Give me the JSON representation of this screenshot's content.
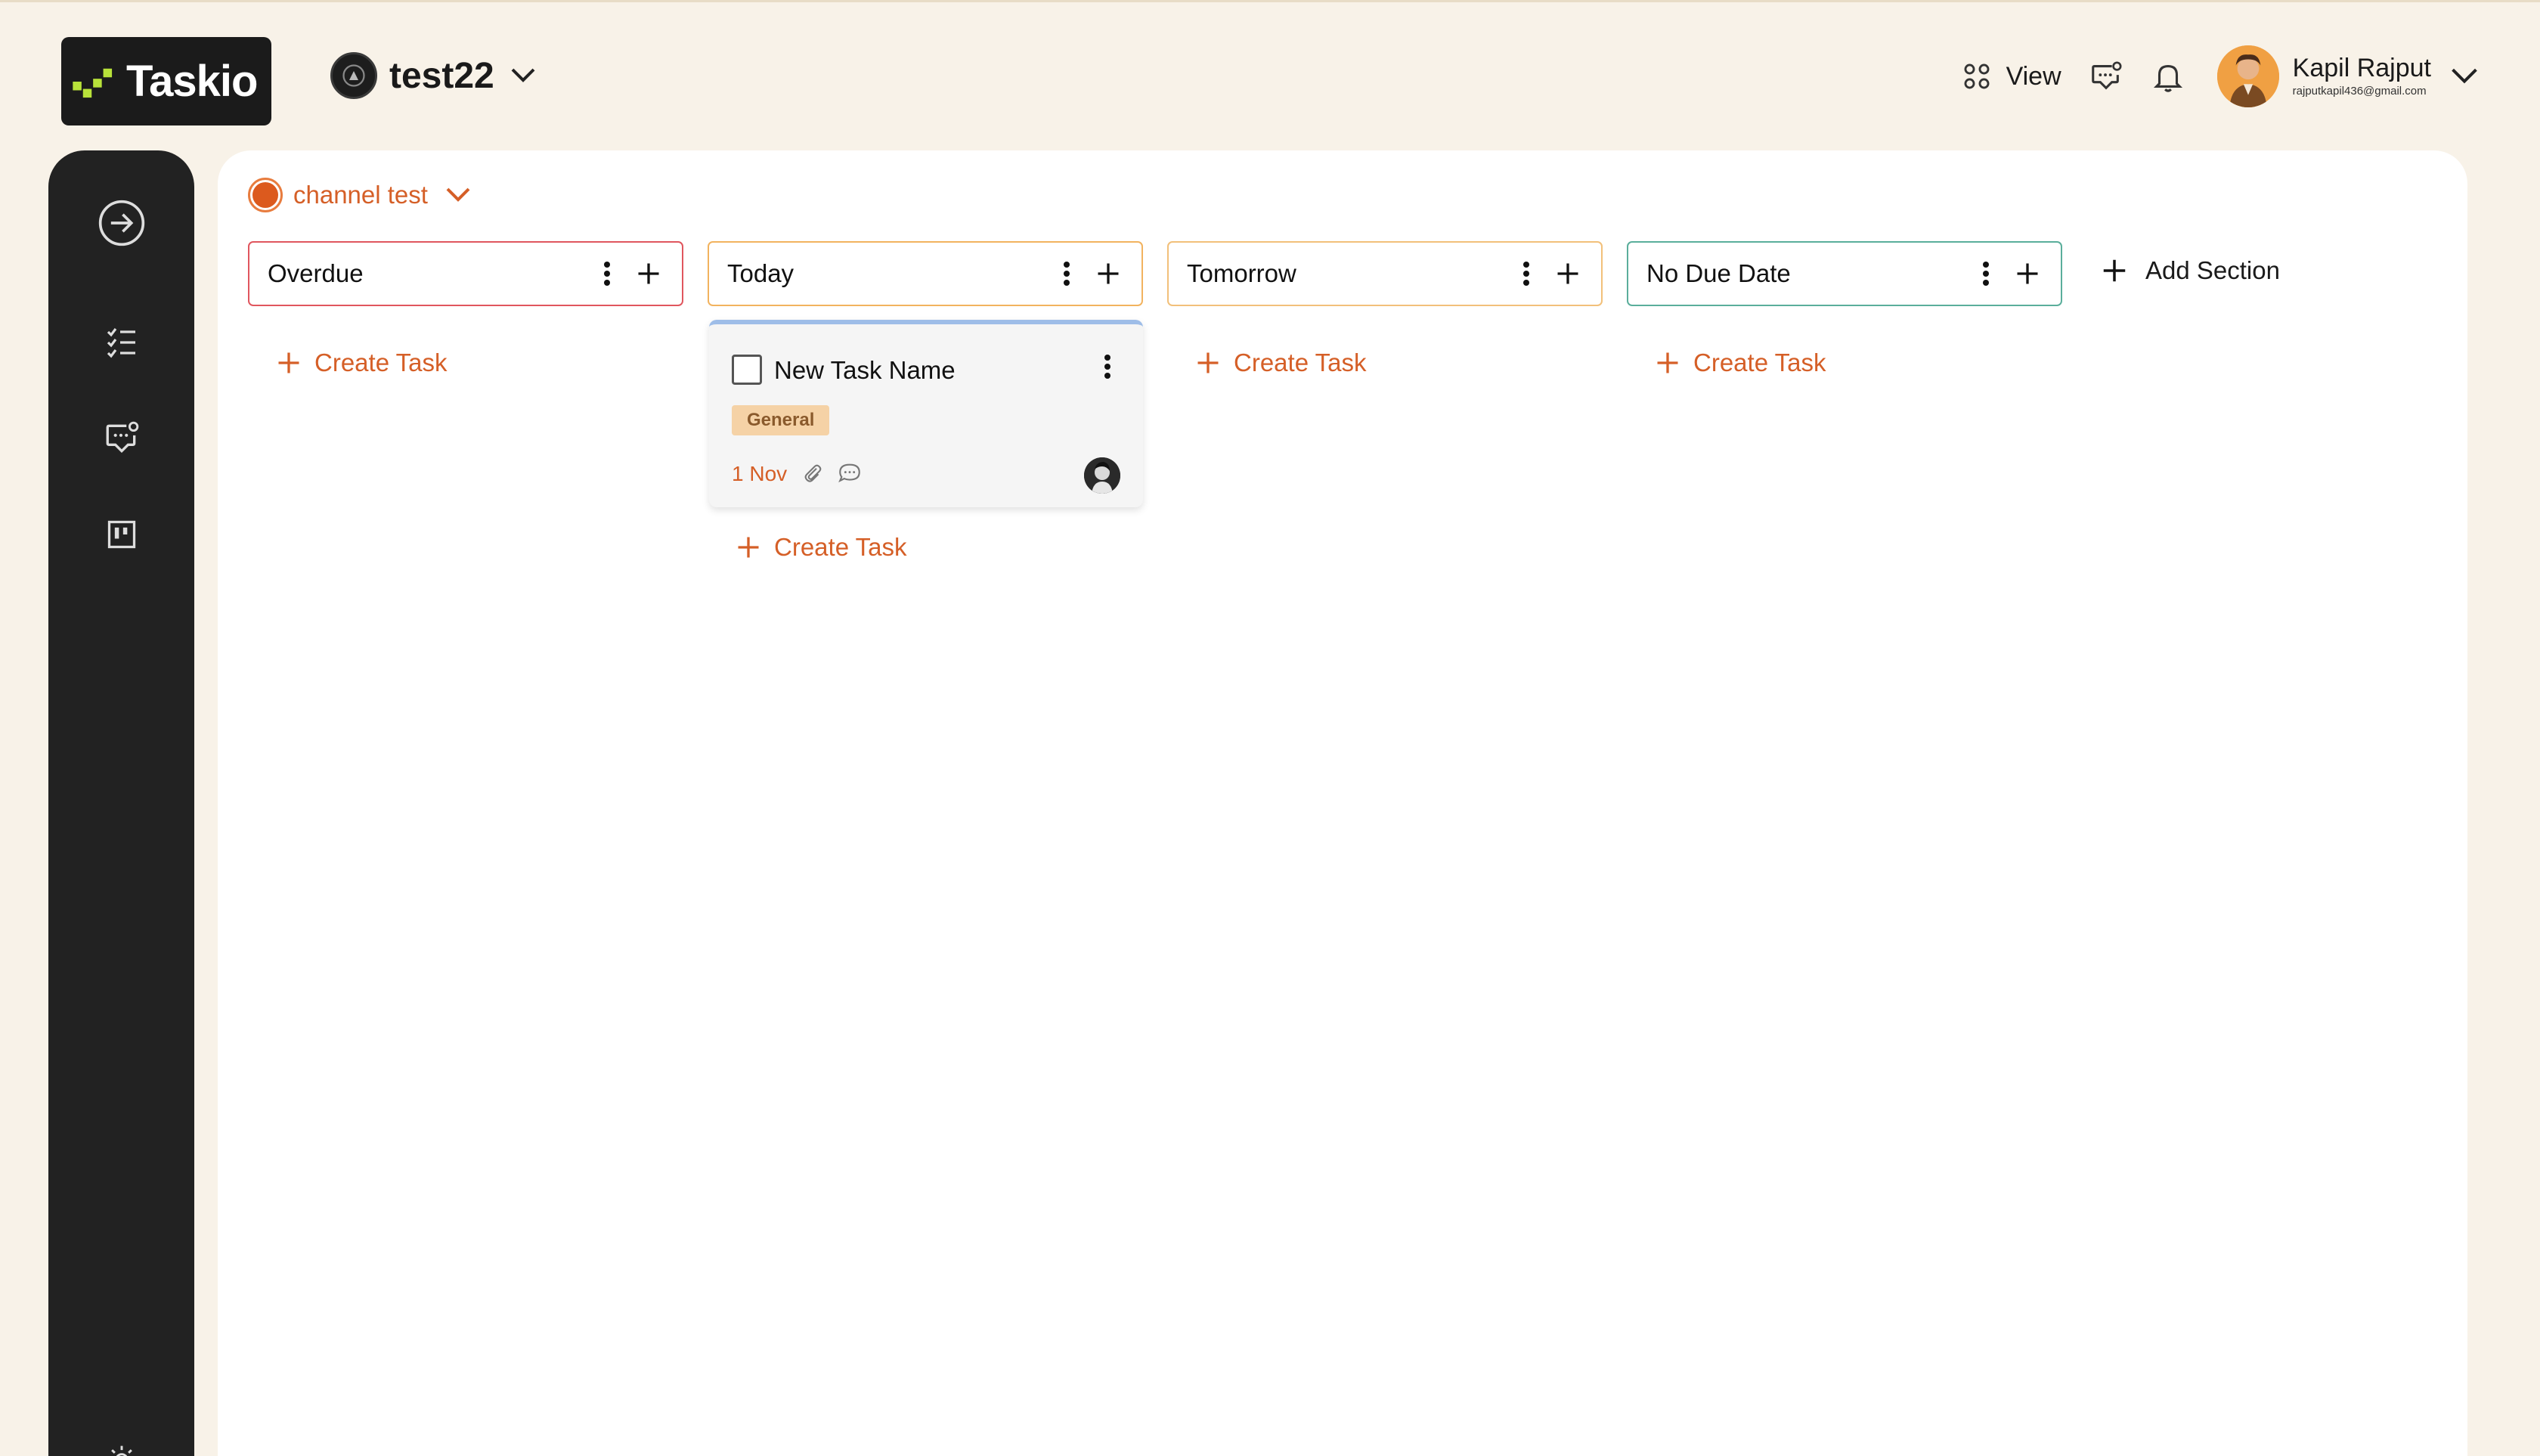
{
  "app": {
    "name": "Taskio"
  },
  "workspace": {
    "name": "test22"
  },
  "header": {
    "view_label": "View",
    "user_name": "Kapil Rajput",
    "user_email": "rajputkapil436@gmail.com"
  },
  "board": {
    "channel_name": "channel test",
    "add_section_label": "Add Section",
    "create_task_label": "Create Task",
    "sections": [
      {
        "title": "Overdue",
        "border_color": "#e0565e"
      },
      {
        "title": "Today",
        "border_color": "#f2b35f"
      },
      {
        "title": "Tomorrow",
        "border_color": "#f2c07a"
      },
      {
        "title": "No Due Date",
        "border_color": "#5aae9b"
      }
    ],
    "task": {
      "name": "New Task Name",
      "tag": "General",
      "due": "1 Nov",
      "top_border_color": "#9ebde8"
    }
  },
  "colors": {
    "accent": "#d55f27",
    "background": "#f8f2e8",
    "sidebar": "#222222",
    "tag_bg": "#f5d2a6"
  },
  "icons": {
    "sidebar": [
      "arrow-right-circle-icon",
      "checklist-icon",
      "chat-settings-icon",
      "board-icon"
    ],
    "header": [
      "grid-view-icon",
      "chat-icon",
      "bell-icon",
      "chevron-down-icon"
    ]
  }
}
